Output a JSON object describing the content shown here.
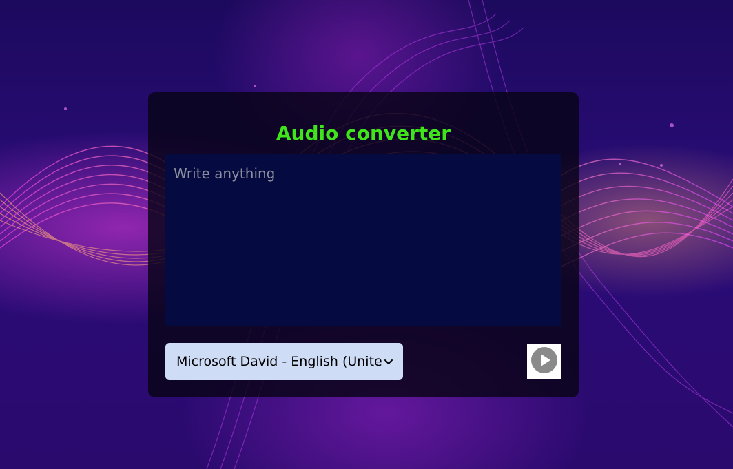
{
  "app": {
    "title": "Audio converter"
  },
  "editor": {
    "value": "",
    "placeholder": "Write anything"
  },
  "voice_select": {
    "selected": "Microsoft David - English (United"
  },
  "controls": {
    "play_icon": "play-circle-icon",
    "chevron_icon": "chevron-down-icon"
  },
  "colors": {
    "title": "#3fe51a",
    "card_background": "#080416",
    "textarea_background": "#050a40",
    "select_background": "#cfdcf5",
    "page_background": "#220a6a"
  }
}
